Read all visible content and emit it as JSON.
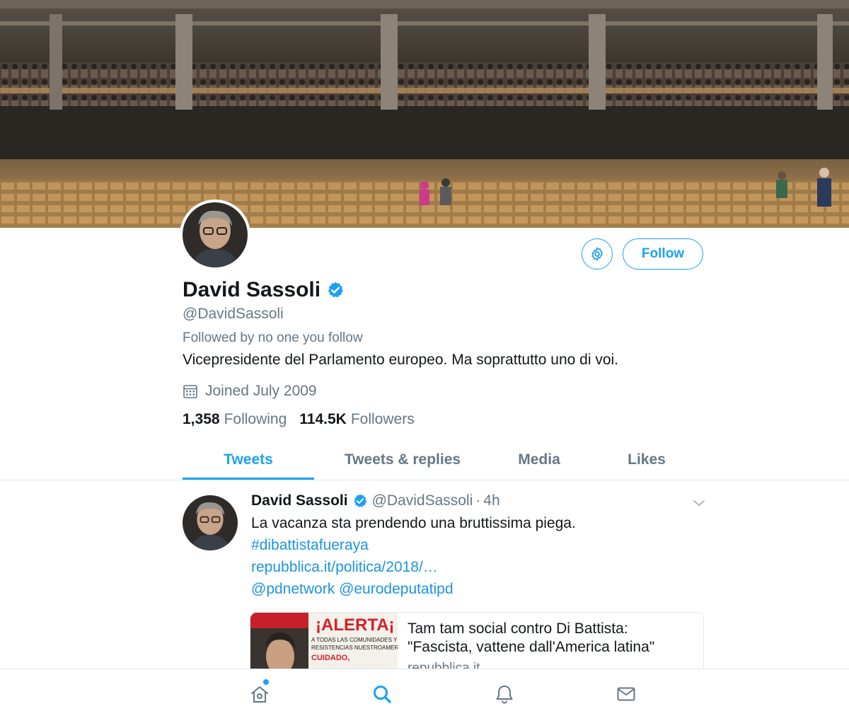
{
  "profile": {
    "display_name": "David Sassoli",
    "verified_icon": "verified-badge-icon",
    "handle": "@DavidSassoli",
    "followed_by": "Followed by no one you follow",
    "bio": "Vicepresidente del Parlamento europeo. Ma soprattutto uno di voi.",
    "joined": "Joined July 2009",
    "following_count": "1,358",
    "following_label": "Following",
    "followers_count": "114.5K",
    "followers_label": "Followers"
  },
  "actions": {
    "follow_label": "Follow",
    "settings_icon": "gear-icon"
  },
  "tabs": [
    {
      "label": "Tweets",
      "active": true
    },
    {
      "label": "Tweets & replies",
      "active": false
    },
    {
      "label": "Media",
      "active": false
    },
    {
      "label": "Likes",
      "active": false
    }
  ],
  "tweet": {
    "author_name": "David Sassoli",
    "author_handle": "@DavidSassoli",
    "separator": "·",
    "time": "4h",
    "text": "La vacanza sta prendendo una bruttissima piega.",
    "hashtag": "#dibattistafueraya",
    "link": "repubblica.it/politica/2018/…",
    "mention_1": "@pdnetwork",
    "mention_2": "@eurodeputatipd",
    "card": {
      "title_line_1": "Tam tam social contro Di Battista:",
      "title_line_2": "\"Fascista, vattene dall'America latina\"",
      "domain": "repubblica.it",
      "thumb_headline": "¡ALERTA¡",
      "thumb_sub_1": "A TODAS LAS COMUNIDADES Y",
      "thumb_sub_2": "RESISTENCIAS NUESTROAMERICANAS",
      "thumb_warn": "CUIDADO,"
    }
  },
  "bottom_nav": [
    {
      "icon": "home-icon",
      "active": false,
      "has_notification_dot": true
    },
    {
      "icon": "search-icon",
      "active": true,
      "has_notification_dot": false
    },
    {
      "icon": "bell-icon",
      "active": false,
      "has_notification_dot": false
    },
    {
      "icon": "mail-icon",
      "active": false,
      "has_notification_dot": false
    }
  ],
  "colors": {
    "accent": "#1da1f2",
    "link": "#1b95e0",
    "text": "#14171a",
    "secondary": "#657786",
    "border": "#e1e8ed"
  }
}
